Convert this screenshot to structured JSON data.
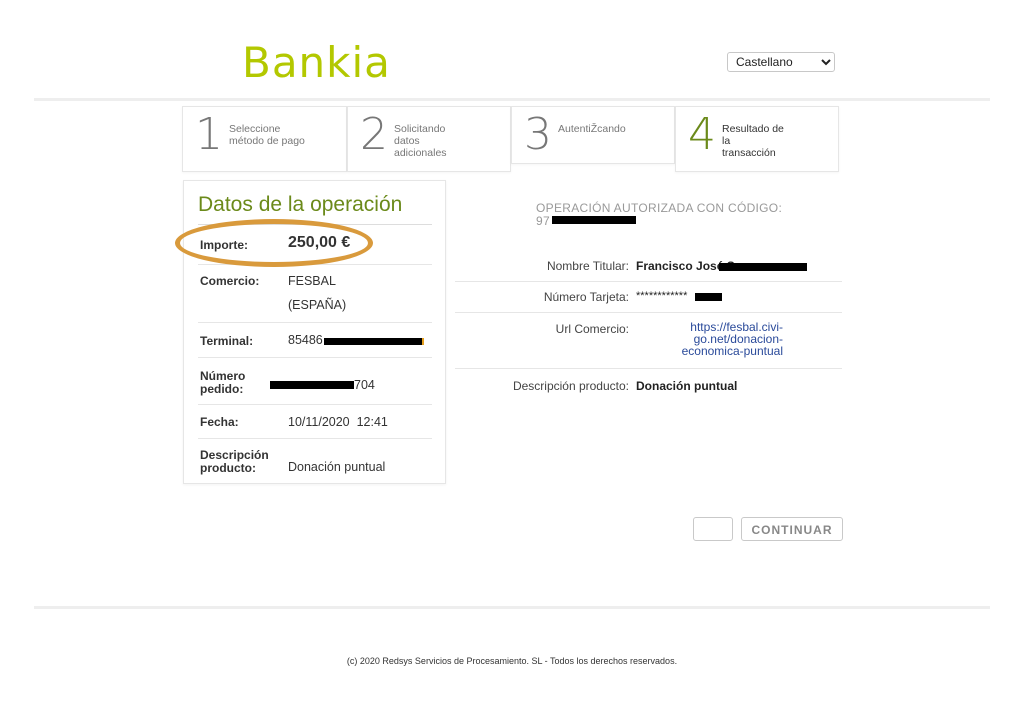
{
  "brand": {
    "logo_text": "Bankia",
    "color": "#b3c800"
  },
  "language": {
    "selected": "Castellano",
    "options": [
      "Castellano"
    ]
  },
  "steps": [
    {
      "number": "1",
      "label_lines": [
        "Seleccione",
        "método de pago"
      ],
      "active": false
    },
    {
      "number": "2",
      "label_lines": [
        "Solicitando",
        "datos",
        "adicionales"
      ],
      "active": false
    },
    {
      "number": "3",
      "label_lines": [
        "AutentiŽcando"
      ],
      "active": false
    },
    {
      "number": "4",
      "label_lines": [
        "Resultado de",
        "la",
        "transacción"
      ],
      "active": true
    }
  ],
  "operation": {
    "title": "Datos de la operación",
    "amount_label": "Importe:",
    "amount_value": "250,00 €",
    "merchant_label": "Comercio:",
    "merchant_value_line1": "FESBAL",
    "merchant_value_line2": "(ESPAÑA)",
    "terminal_label": "Terminal:",
    "terminal_value": "85486",
    "order_label_line1": "Número",
    "order_label_line2": "pedido:",
    "order_value": "704",
    "date_label": "Fecha:",
    "date_value": "10/11/2020  12:41",
    "description_label_line1": "Descripción",
    "description_label_line2": "producto:",
    "description_value": "Donación puntual"
  },
  "result": {
    "authorized_title": "OPERACIÓN AUTORIZADA CON CÓDIGO:",
    "authorized_code": "97",
    "holder_label": "Nombre Titular:",
    "holder_value": "Francisco José S",
    "card_label": "Número Tarjeta:",
    "card_value": "************",
    "url_label": "Url Comercio:",
    "url_value": "https://fesbal.civi-go.net/donacion-economica-puntual",
    "url_lines": [
      "https://fesbal.civi-",
      "go.net/donacion-",
      "economica-puntual"
    ],
    "description_label": "Descripción producto:",
    "description_value": "Donación puntual"
  },
  "actions": {
    "continue_label": "CONTINUAR"
  },
  "footer": {
    "text": "(c) 2020 Redsys Servicios de Procesamiento. SL - Todos los derechos reservados."
  },
  "colors": {
    "accent_green": "#6b8a1a",
    "highlight_orange": "#d99a3c",
    "link_blue": "#2a4a9a"
  }
}
